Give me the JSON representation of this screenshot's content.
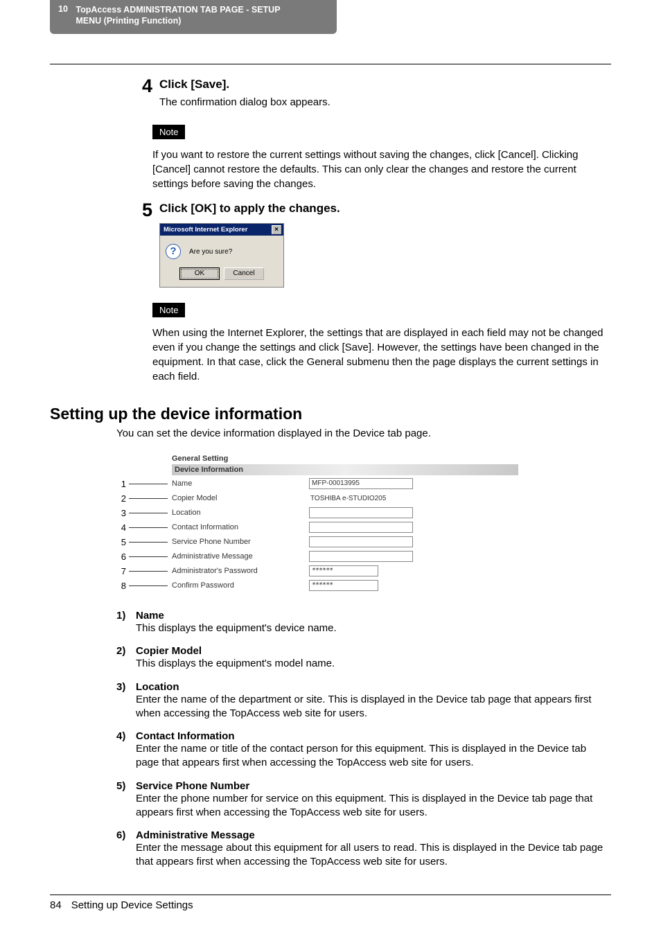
{
  "chapter": {
    "number": "10",
    "title_line1": "TopAccess ADMINISTRATION TAB PAGE - SETUP",
    "title_line2": "MENU (Printing Function)"
  },
  "step4": {
    "number": "4",
    "title": "Click [Save].",
    "desc": "The confirmation dialog box appears.",
    "note_label": "Note",
    "note_text": "If you want to restore the current settings without saving the changes, click [Cancel]. Clicking [Cancel] cannot restore the defaults.  This can only clear the changes and restore the current settings before saving the changes."
  },
  "step5": {
    "number": "5",
    "title": "Click [OK] to apply the changes.",
    "dialog": {
      "titlebar": "Microsoft Internet Explorer",
      "close": "×",
      "message": "Are you sure?",
      "ok": "OK",
      "cancel": "Cancel"
    },
    "note_label": "Note",
    "note_text": "When using the Internet Explorer, the settings that are displayed in each field may not be changed even if you change the settings and click [Save].  However, the settings have been changed in the equipment.  In that case, click the General submenu then the page displays the current settings in each field."
  },
  "section": {
    "heading": "Setting up the device information",
    "intro": "You can set the device information displayed in the Device tab page."
  },
  "devinfo": {
    "panel_heading": "General Setting",
    "panel_sub": "Device Information",
    "rows": {
      "r1": {
        "num": "1",
        "label": "Name",
        "value": "MFP-00013995",
        "type": "input"
      },
      "r2": {
        "num": "2",
        "label": "Copier Model",
        "value": "TOSHIBA e-STUDIO205",
        "type": "text"
      },
      "r3": {
        "num": "3",
        "label": "Location",
        "value": "",
        "type": "input"
      },
      "r4": {
        "num": "4",
        "label": "Contact Information",
        "value": "",
        "type": "input"
      },
      "r5": {
        "num": "5",
        "label": "Service Phone Number",
        "value": "",
        "type": "input"
      },
      "r6": {
        "num": "6",
        "label": "Administrative Message",
        "value": "",
        "type": "input"
      },
      "r7": {
        "num": "7",
        "label": "Administrator's Password",
        "value": "******",
        "type": "pw"
      },
      "r8": {
        "num": "8",
        "label": "Confirm Password",
        "value": "******",
        "type": "pw"
      }
    }
  },
  "defs": {
    "d1": {
      "num": "1)",
      "term": "Name",
      "desc": "This displays the equipment's device name."
    },
    "d2": {
      "num": "2)",
      "term": "Copier Model",
      "desc": "This displays the equipment's model name."
    },
    "d3": {
      "num": "3)",
      "term": "Location",
      "desc": "Enter the name of the department or site. This is displayed in the Device tab page that appears first when accessing the TopAccess web site for users."
    },
    "d4": {
      "num": "4)",
      "term": "Contact Information",
      "desc": "Enter the name or title of the contact person for this equipment.  This is displayed in the Device tab page that appears first when accessing the TopAccess web site for users."
    },
    "d5": {
      "num": "5)",
      "term": "Service Phone Number",
      "desc": "Enter the phone number for service on this equipment.  This is displayed in the Device tab page that appears first when accessing the TopAccess web site for users."
    },
    "d6": {
      "num": "6)",
      "term": "Administrative Message",
      "desc": "Enter the message about this equipment for all users to read.  This is displayed in the Device tab page that appears first when accessing the TopAccess web site for users."
    }
  },
  "footer": {
    "page": "84",
    "title": "Setting up Device Settings"
  }
}
